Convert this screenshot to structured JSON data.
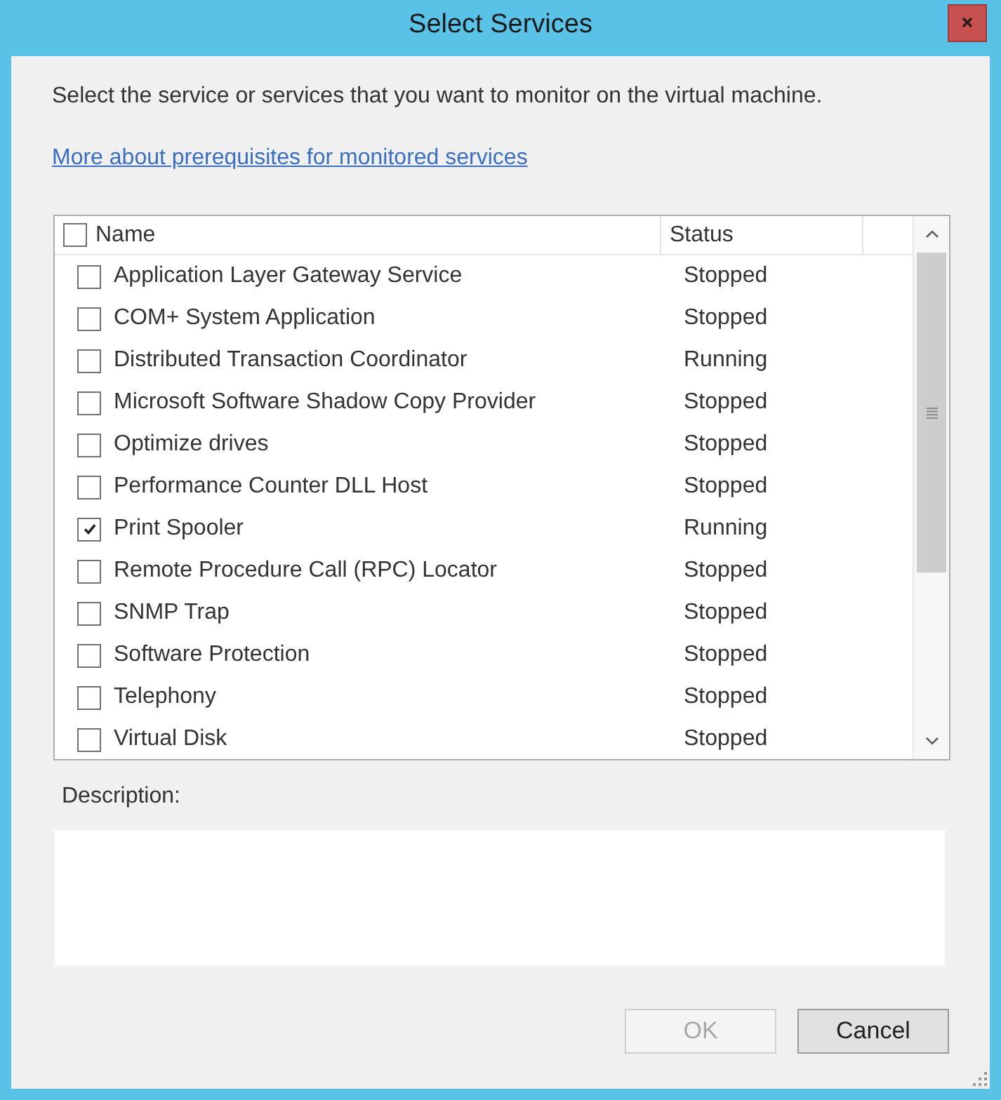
{
  "window": {
    "title": "Select Services"
  },
  "instruction": "Select the service or services that you want to monitor on the virtual machine.",
  "link": "More about prerequisites for monitored services",
  "services_list": {
    "select_all_checked": false,
    "columns": [
      {
        "label": "Name"
      },
      {
        "label": "Status"
      }
    ],
    "rows": [
      {
        "name": "Application Layer Gateway Service",
        "status": "Stopped",
        "checked": false
      },
      {
        "name": "COM+ System Application",
        "status": "Stopped",
        "checked": false
      },
      {
        "name": "Distributed Transaction Coordinator",
        "status": "Running",
        "checked": false
      },
      {
        "name": "Microsoft Software Shadow Copy Provider",
        "status": "Stopped",
        "checked": false
      },
      {
        "name": "Optimize drives",
        "status": "Stopped",
        "checked": false
      },
      {
        "name": "Performance Counter DLL Host",
        "status": "Stopped",
        "checked": false
      },
      {
        "name": "Print Spooler",
        "status": "Running",
        "checked": true
      },
      {
        "name": "Remote Procedure Call (RPC) Locator",
        "status": "Stopped",
        "checked": false
      },
      {
        "name": "SNMP Trap",
        "status": "Stopped",
        "checked": false
      },
      {
        "name": "Software Protection",
        "status": "Stopped",
        "checked": false
      },
      {
        "name": "Telephony",
        "status": "Stopped",
        "checked": false
      },
      {
        "name": "Virtual Disk",
        "status": "Stopped",
        "checked": false
      }
    ]
  },
  "description": {
    "label": "Description:"
  },
  "buttons": [
    {
      "label": "OK",
      "disabled": true
    },
    {
      "label": "Cancel",
      "disabled": false
    }
  ]
}
